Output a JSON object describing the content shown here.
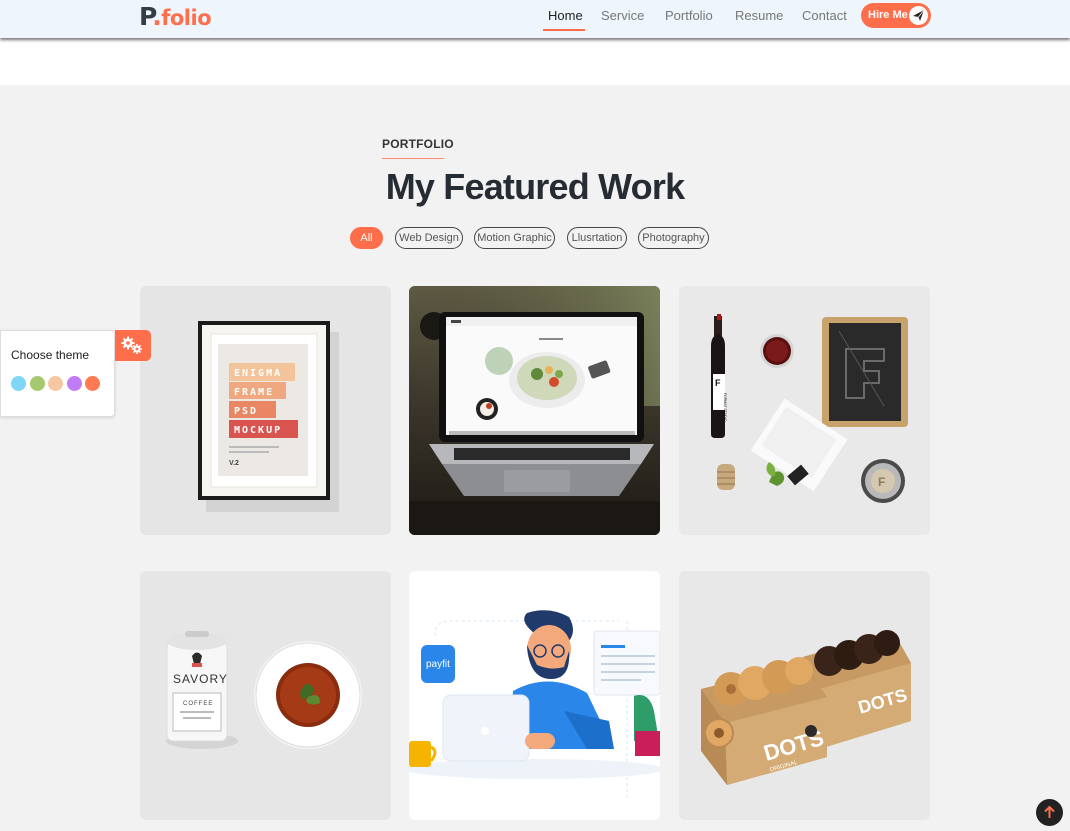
{
  "header": {
    "logo_p": "P",
    "logo_dot": ".",
    "logo_rest": "folio",
    "nav": [
      {
        "label": "Home",
        "active": true
      },
      {
        "label": "Service",
        "active": false
      },
      {
        "label": "Portfolio",
        "active": false
      },
      {
        "label": "Resume",
        "active": false
      },
      {
        "label": "Contact",
        "active": false
      }
    ],
    "hire_label": "Hire Me",
    "hire_icon": "paper-plane-icon"
  },
  "section": {
    "eyebrow": "PORTFOLIO",
    "title": "My Featured Work"
  },
  "filters": [
    {
      "label": "All",
      "active": true
    },
    {
      "label": "Web Design",
      "active": false
    },
    {
      "label": "Motion Graphic",
      "active": false
    },
    {
      "label": "Llusrtation",
      "active": false
    },
    {
      "label": "Photography",
      "active": false
    }
  ],
  "portfolio": [
    {
      "id": "enigma-frame",
      "lines": [
        "ENIGMA",
        "FRAME",
        "PSD",
        "MOCKUP"
      ],
      "version": "V.2"
    },
    {
      "id": "laptop-photo"
    },
    {
      "id": "wine-branding",
      "bottle_letter": "F",
      "bottle_text": "FORMAT STUDIO"
    },
    {
      "id": "savory-coffee",
      "brand": "SAVORY",
      "label": "COFFEE"
    },
    {
      "id": "payfit-illustration",
      "badge": "payfit"
    },
    {
      "id": "dots-donuts",
      "brand": "DOTS",
      "sub": "ORIGINAL"
    }
  ],
  "theme": {
    "title": "Choose theme",
    "colors": [
      "#7fd6f7",
      "#a6c86e",
      "#f7c7a2",
      "#c17cf5",
      "#ff7a52"
    ],
    "gear_icon": "gears-icon"
  },
  "colors": {
    "accent": "#ff6e4a",
    "header_bg": "#eef5fc",
    "page_bg": "#f2f2f2"
  },
  "scroll_icon": "arrow-up-icon"
}
